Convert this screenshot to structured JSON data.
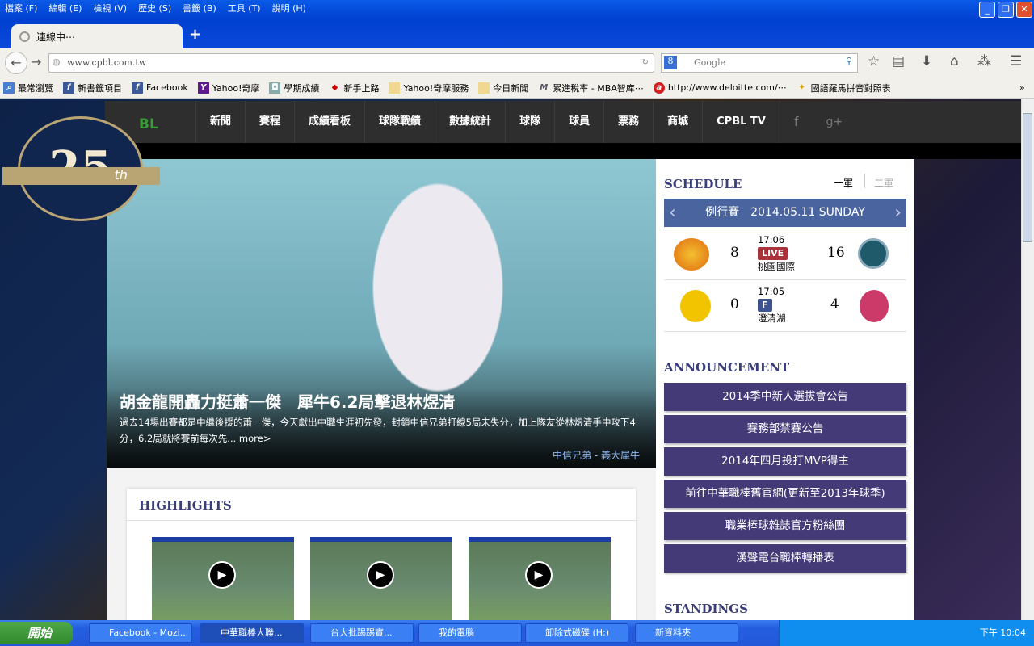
{
  "browser": {
    "menu": [
      "檔案 (F)",
      "編輯 (E)",
      "檢視 (V)",
      "歷史 (S)",
      "書籤 (B)",
      "工具 (T)",
      "說明 (H)"
    ],
    "tab_title": "連線中⋯",
    "url": "www.cpbl.com.tw",
    "search_placeholder": "Google",
    "bookmarks": [
      "最常瀏覽",
      "新書籤項目",
      "Facebook",
      "Yahoo!奇摩",
      "學期成績",
      "新手上路",
      "Yahoo!奇摩服務",
      "今日新聞",
      "累進稅率 - MBA智库⋯",
      "http://www.deloitte.com/⋯",
      "國語羅馬拼音對照表"
    ],
    "bookmarks_more": "»"
  },
  "site": {
    "logo_text": "SINCE 1990 CPBL 25th Anniversary Season",
    "nav": [
      "新聞",
      "賽程",
      "成績看板",
      "球隊戰績",
      "數據統計",
      "球隊",
      "球員",
      "票務",
      "商城",
      "CPBL TV"
    ],
    "social": [
      "f",
      "g+"
    ],
    "hero": {
      "title": "胡金龍開轟力挺蕭一傑　犀牛6.2局擊退林煜清",
      "desc": "過去14場出賽都是中繼後援的蕭一傑，今天獻出中職生涯初先發，封鎖中信兄弟打線5局未失分，加上隊友從林煜清手中攻下4分，6.2局就將賽前每次先...",
      "more": "more>",
      "tag": "中信兄弟 - 義大犀牛"
    },
    "highlights_title": "HIGHLIGHTS",
    "schedule": {
      "title": "SCHEDULE",
      "tabs": [
        "一軍",
        "二軍"
      ],
      "date": "例行賽　2014.05.11 SUNDAY",
      "games": [
        {
          "away_score": "8",
          "time": "17:06",
          "status": "LIVE",
          "status_color": "#a8333a",
          "venue": "桃園國際",
          "home_score": "16"
        },
        {
          "away_score": "0",
          "time": "17:05",
          "status": "F",
          "status_color": "#3e5290",
          "venue": "澄清湖",
          "home_score": "4"
        }
      ]
    },
    "announcement_title": "ANNOUNCEMENT",
    "announcements": [
      "2014季中新人選拔會公告",
      "賽務部禁賽公告",
      "2014年四月投打MVP得主",
      "前往中華職棒舊官網(更新至2013年球季)",
      "職業棒球雜誌官方粉絲團",
      "漢聲電台職棒轉播表"
    ],
    "standings_title": "STANDINGS"
  },
  "taskbar": {
    "start": "開始",
    "tasks": [
      "Facebook - Mozi...",
      "中華職棒大聯...",
      "台大批踢踢實...",
      "我的電腦",
      "卸除式磁碟 (H:)",
      "新資料夾"
    ],
    "clock": "下午 10:04"
  }
}
